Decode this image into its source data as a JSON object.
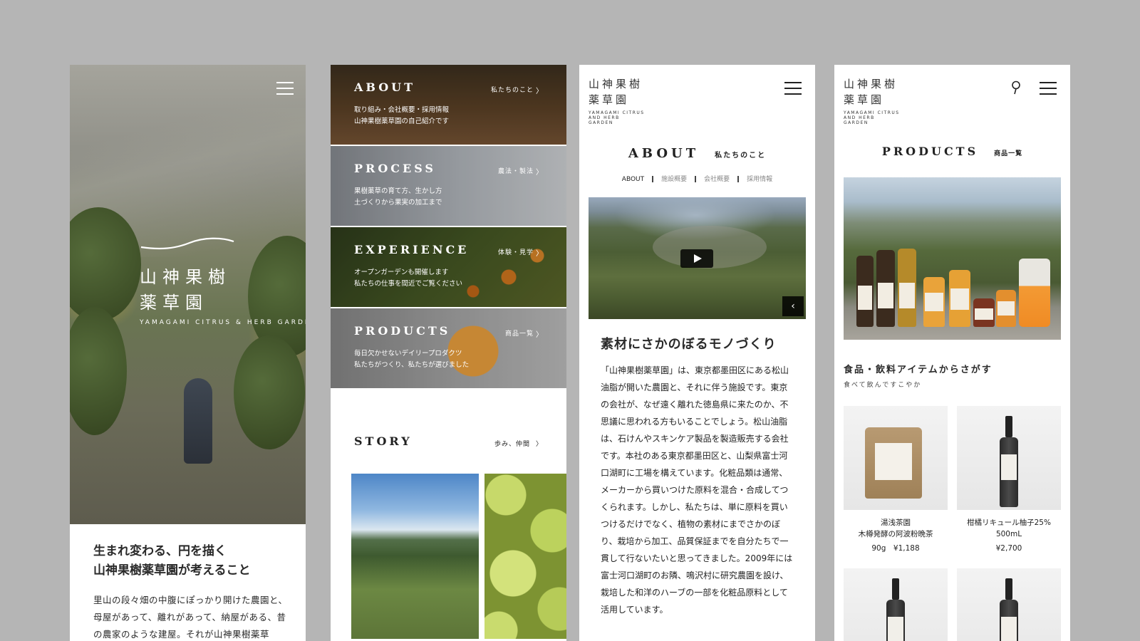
{
  "screen1": {
    "brand_line1": "山神果樹",
    "brand_line2": "薬草園",
    "brand_en": "YAMAGAMI CITRUS & HERB GARDEN",
    "heading_line1": "生まれ変わる、円を描く",
    "heading_line2": "山神果樹薬草園が考えること",
    "body": "里山の段々畑の中腹にぽっかり開けた農園と、母屋があって、離れがあって、納屋がある、昔の農家のような建屋。それが山神果樹薬草"
  },
  "screen2": {
    "nav": [
      {
        "title": "ABOUT",
        "jp": "私たちのこと",
        "desc_line1": "取り組み・会社概要・採用情報",
        "desc_line2": "山神果樹薬草園の自己紹介です"
      },
      {
        "title": "PROCESS",
        "jp": "農法・製法",
        "desc_line1": "果樹薬草の育て方、生かし方",
        "desc_line2": "土づくりから果実の加工まで"
      },
      {
        "title": "EXPERIENCE",
        "jp": "体験・見学",
        "desc_line1": "オープンガーデンも開催します",
        "desc_line2": "私たちの仕事を間近でご覧ください"
      },
      {
        "title": "PRODUCTS",
        "jp": "商品一覧",
        "desc_line1": "毎日欠かせないデイリープロダクツ",
        "desc_line2": "私たちがつくり、私たちが選びました"
      }
    ],
    "story_title": "STORY",
    "story_link": "歩み、仲間"
  },
  "header": {
    "brand_line1": "山神果樹",
    "brand_line2": "薬草園",
    "brand_en": "YAMAGAMI CITRUS AND HERB GARDEN"
  },
  "screen3": {
    "title_en": "ABOUT",
    "title_jp": "私たちのこと",
    "tabs": [
      "ABOUT",
      "施設概要",
      "会社概要",
      "採用情報"
    ],
    "heading": "素材にさかのぼるモノづくり",
    "body": "「山神果樹薬草園」は、東京都墨田区にある松山油脂が開いた農園と、それに伴う施設です。東京の会社が、なぜ遠く離れた徳島県に来たのか、不思議に思われる方もいることでしょう。松山油脂は、石けんやスキンケア製品を製造販売する会社です。本社のある東京都墨田区と、山梨県富士河口湖町に工場を構えています。化粧品類は通常、メーカーから買いつけた原料を混合・合成してつくられます。しかし、私たちは、単に原料を買いつけるだけでなく、植物の素材にまでさかのぼり、栽培から加工、品質保証までを自分たちで一貫して行ないたいと思ってきました。2009年には富士河口湖町のお隣、鳴沢村に研究農園を設け、栽培した和洋のハーブの一部を化粧品原料として活用しています。"
  },
  "screen4": {
    "title_en": "PRODUCTS",
    "title_jp": "商品一覧",
    "category": "食品・飲料アイテムからさがす",
    "category_sub": "食べて飲んですこやか",
    "products": [
      {
        "name": "湯浅茶園\n木樽発酵の阿波粉晩茶",
        "price": "90g　¥1,188"
      },
      {
        "name": "柑橘リキュール柚子25%\n500mL",
        "price": "¥2,700"
      }
    ]
  },
  "colors": {
    "background": "#b5b5b5",
    "text": "#222222",
    "white": "#ffffff"
  }
}
